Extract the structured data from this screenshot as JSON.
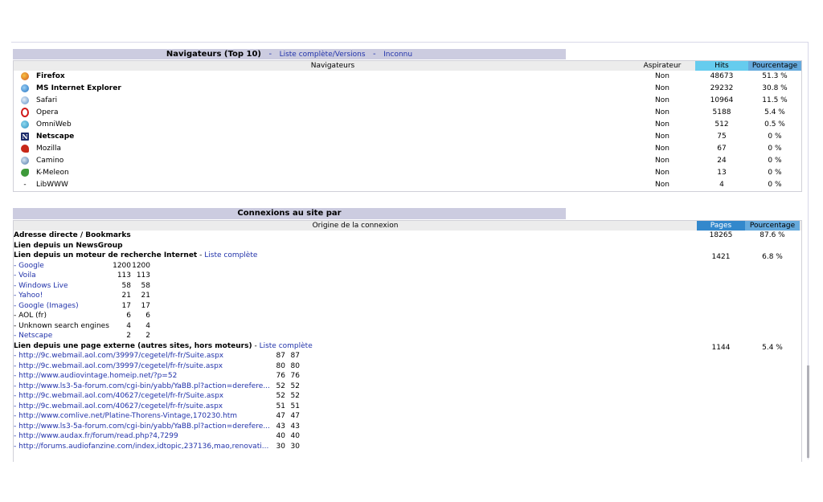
{
  "browsers": {
    "title": "Navigateurs (Top 10)",
    "separator": "-",
    "link_full": "Liste complète/Versions",
    "link_unknown": "Inconnu",
    "headers": {
      "name": "Navigateurs",
      "aspirateur": "Aspirateur",
      "hits": "Hits",
      "pct": "Pourcentage"
    },
    "rows": [
      {
        "icon": "firefox-icon",
        "name": "Firefox",
        "bold": true,
        "aspirateur": "Non",
        "hits": "48673",
        "pct": "51.3 %"
      },
      {
        "icon": "internet-explorer-icon",
        "name": "MS Internet Explorer",
        "bold": true,
        "aspirateur": "Non",
        "hits": "29232",
        "pct": "30.8 %"
      },
      {
        "icon": "safari-icon",
        "name": "Safari",
        "bold": false,
        "aspirateur": "Non",
        "hits": "10964",
        "pct": "11.5 %"
      },
      {
        "icon": "opera-icon",
        "name": "Opera",
        "bold": false,
        "aspirateur": "Non",
        "hits": "5188",
        "pct": "5.4 %"
      },
      {
        "icon": "omniweb-icon",
        "name": "OmniWeb",
        "bold": false,
        "aspirateur": "Non",
        "hits": "512",
        "pct": "0.5 %"
      },
      {
        "icon": "netscape-icon",
        "name": "Netscape",
        "bold": true,
        "aspirateur": "Non",
        "hits": "75",
        "pct": "0 %"
      },
      {
        "icon": "mozilla-icon",
        "name": "Mozilla",
        "bold": false,
        "aspirateur": "Non",
        "hits": "67",
        "pct": "0 %"
      },
      {
        "icon": "camino-icon",
        "name": "Camino",
        "bold": false,
        "aspirateur": "Non",
        "hits": "24",
        "pct": "0 %"
      },
      {
        "icon": "k-meleon-icon",
        "name": "K-Meleon",
        "bold": false,
        "aspirateur": "Non",
        "hits": "13",
        "pct": "0 %"
      },
      {
        "icon": "dash-icon",
        "name": "LibWWW",
        "bold": false,
        "aspirateur": "Non",
        "hits": "4",
        "pct": "0 %"
      }
    ]
  },
  "connexions": {
    "title": "Connexions au site par",
    "headers": {
      "origin": "Origine de la connexion",
      "pages": "Pages",
      "pct": "Pourcentage"
    },
    "direct": {
      "label": "Adresse directe / Bookmarks",
      "pages": "18265",
      "pct": "87.6 %"
    },
    "newsgroup": {
      "label": "Lien depuis un NewsGroup"
    },
    "search": {
      "label": "Lien depuis un moteur de recherche Internet",
      "sep": "-",
      "link": "Liste complète",
      "pages": "1421",
      "pct": "6.8 %",
      "items": [
        {
          "name": "- Google",
          "a": "1200",
          "b": "1200",
          "link": true
        },
        {
          "name": "- Voila",
          "a": "113",
          "b": "113",
          "link": true
        },
        {
          "name": "- Windows Live",
          "a": "58",
          "b": "58",
          "link": true
        },
        {
          "name": "- Yahoo!",
          "a": "21",
          "b": "21",
          "link": true
        },
        {
          "name": "- Google (Images)",
          "a": "17",
          "b": "17",
          "link": true
        },
        {
          "name": "- AOL (fr)",
          "a": "6",
          "b": "6",
          "link": false
        },
        {
          "name": "- Unknown search engines",
          "a": "4",
          "b": "4",
          "link": false
        },
        {
          "name": "- Netscape",
          "a": "2",
          "b": "2",
          "link": true
        }
      ]
    },
    "external": {
      "label": "Lien depuis une page externe (autres sites, hors moteurs)",
      "sep": "-",
      "link": "Liste complète",
      "pages": "1144",
      "pct": "5.4 %",
      "items": [
        {
          "name": "- http://9c.webmail.aol.com/39997/cegetel/fr-fr/Suite.aspx",
          "a": "87",
          "b": "87"
        },
        {
          "name": "- http://9c.webmail.aol.com/39997/cegetel/fr-fr/suite.aspx",
          "a": "80",
          "b": "80"
        },
        {
          "name": "- http://www.audiovintage.homeip.net/?p=52",
          "a": "76",
          "b": "76"
        },
        {
          "name": "- http://www.ls3-5a-forum.com/cgi-bin/yabb/YaBB.pl?action=derefere...",
          "a": "52",
          "b": "52"
        },
        {
          "name": "- http://9c.webmail.aol.com/40627/cegetel/fr-fr/Suite.aspx",
          "a": "52",
          "b": "52"
        },
        {
          "name": "- http://9c.webmail.aol.com/40627/cegetel/fr-fr/suite.aspx",
          "a": "51",
          "b": "51"
        },
        {
          "name": "- http://www.comlive.net/Platine-Thorens-Vintage,170230.htm",
          "a": "47",
          "b": "47"
        },
        {
          "name": "- http://www.ls3-5a-forum.com/cgi-bin/yabb/YaBB.pl?action=derefere...",
          "a": "43",
          "b": "43"
        },
        {
          "name": "- http://www.audax.fr/forum/read.php?4,7299",
          "a": "40",
          "b": "40"
        },
        {
          "name": "- http://forums.audiofanzine.com/index,idtopic,237136,mao,renovati...",
          "a": "30",
          "b": "30"
        }
      ]
    }
  }
}
